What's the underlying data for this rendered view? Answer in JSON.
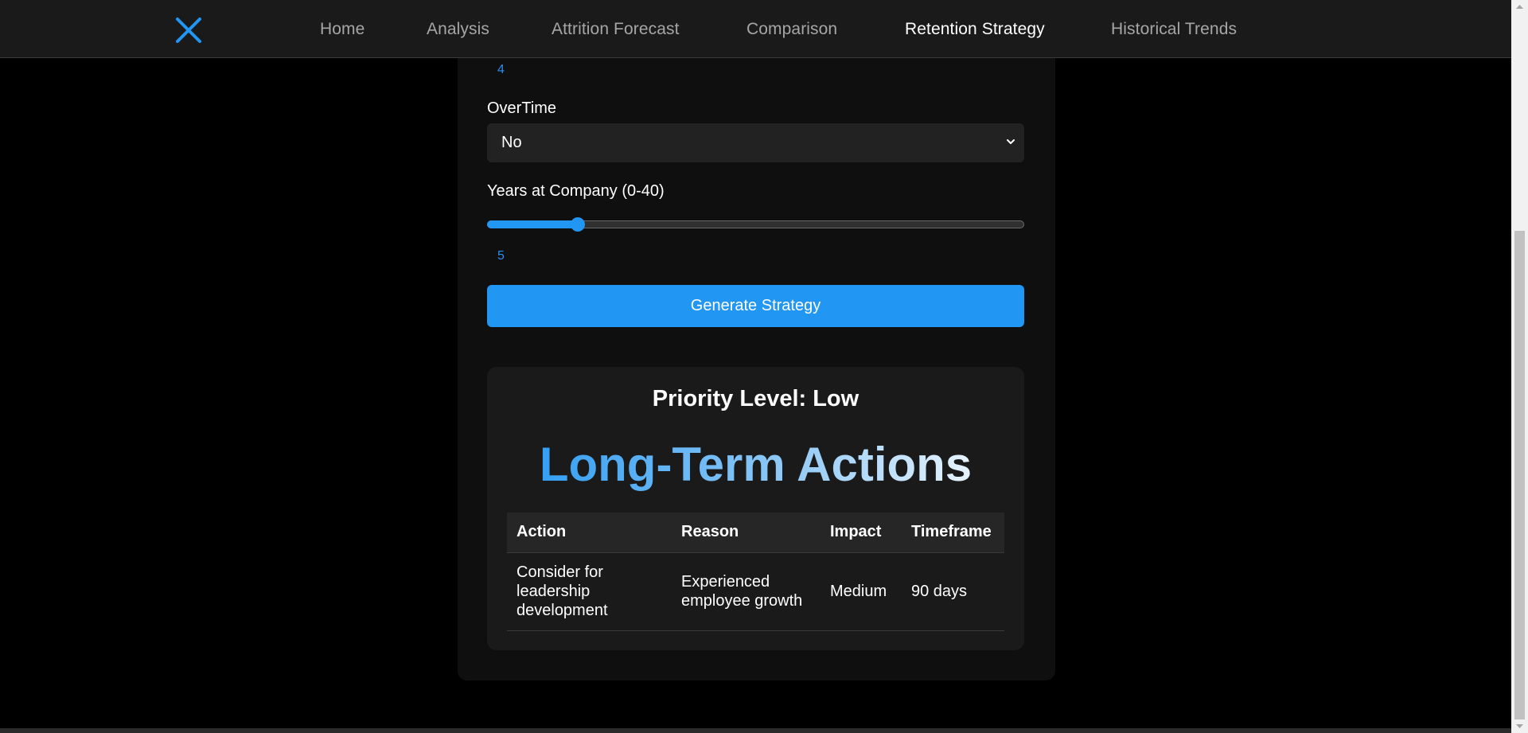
{
  "nav": {
    "links": [
      {
        "label": "Home"
      },
      {
        "label": "Analysis"
      },
      {
        "label": "Attrition Forecast"
      },
      {
        "label": "Comparison"
      },
      {
        "label": "Retention Strategy"
      },
      {
        "label": "Historical Trends"
      }
    ],
    "active_index": 4,
    "logo_icon": "x-logo-icon",
    "accent_color": "#2196f3"
  },
  "form": {
    "prev_slider_value": "4",
    "overtime": {
      "label": "OverTime",
      "value": "No"
    },
    "years": {
      "label": "Years at Company (0-40)",
      "value": 5,
      "min": 0,
      "max": 40,
      "display": "5"
    },
    "generate_label": "Generate Strategy"
  },
  "result": {
    "priority": "Priority Level: Low",
    "headline": "Long-Term Actions",
    "table": {
      "headers": [
        "Action",
        "Reason",
        "Impact",
        "Timeframe"
      ],
      "rows": [
        [
          "Consider for leadership development",
          "Experienced employee growth",
          "Medium",
          "90 days"
        ]
      ]
    }
  }
}
